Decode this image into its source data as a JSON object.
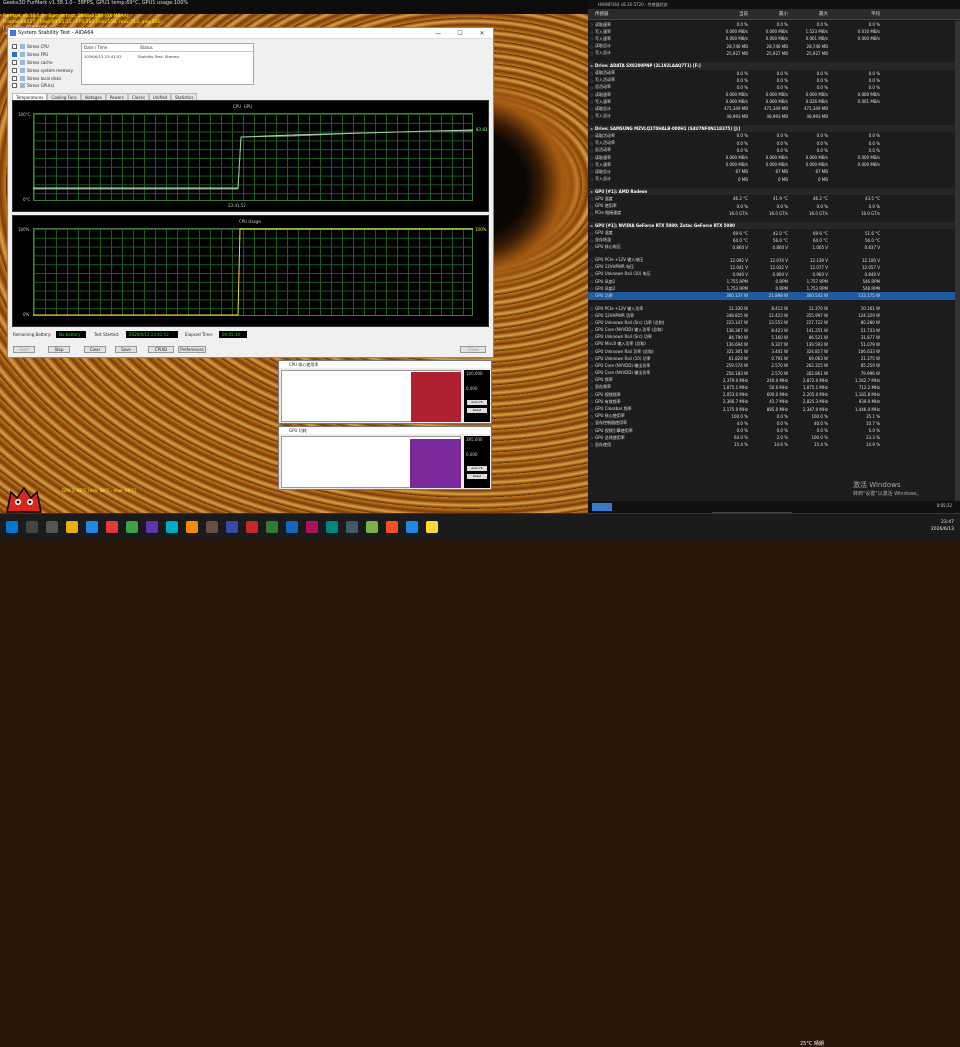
{
  "furmark": {
    "title_line": "Geeks3D FurMark v1.38.1.0 - 38FPS, GPU1 temp:69°C, GPU1 usage:100%",
    "info1": "FurMark v1.38.1.0 - Burn-in test, 2048x1152 (0X MSAA)",
    "info2": "Frames:88517 - time:00:05:15 - FPS:281 (min:159, max:213, avg:306)",
    "info3": "[ GeForce RTX 5080 ]",
    "info4": "- GPU 1 (NVIDIA GeForce RTX 5080) - core: 2887MHz, mem: 15000MHz, GPU load: 100%, mem load: 18%, fan: 31%",
    "bottom": "GPU 1: 68°C (min: 68°C - max: 69°C)"
  },
  "stability": {
    "title": "System Stability Test - AIDA64",
    "checks": [
      {
        "label": "Stress CPU",
        "on": false
      },
      {
        "label": "Stress FPU",
        "on": true
      },
      {
        "label": "Stress cache",
        "on": false
      },
      {
        "label": "Stress system memory",
        "on": false
      },
      {
        "label": "Stress local disks",
        "on": false
      },
      {
        "label": "Stress GPU(s)",
        "on": false
      }
    ],
    "log_headers": [
      "Date / Time",
      "Status"
    ],
    "log_row": {
      "date": "2026/6/13 23:41:52",
      "status": "Stability Test: Started"
    },
    "tabs": [
      "Temperatures",
      "Cooling Fans",
      "Voltages",
      "Powers",
      "Clocks",
      "Unified",
      "Statistics"
    ],
    "graph1": {
      "legend_cpu": "CPU",
      "legend_gpu": "GPU",
      "top": "100°C",
      "bottom": "0°C",
      "time": "23:41:52",
      "value": "83 83"
    },
    "graph2": {
      "title": "CPU Usage",
      "top": "100%",
      "bottom": "0%",
      "value": "100%"
    },
    "remaining_battery_label": "Remaining Battery:",
    "remaining_battery": "No battery",
    "test_started_label": "Test Started:",
    "test_started": "2026/6/13 23:41:52",
    "elapsed_label": "Elapsed Time:",
    "elapsed": "00:05:14",
    "buttons": [
      "Start",
      "Stop",
      "Clear",
      "Save",
      "CPUID",
      "Preferences"
    ],
    "close": "Close",
    "titlebar_controls": [
      "—",
      "☐",
      "✕"
    ]
  },
  "mini1": {
    "title": "CPU 核心使用率",
    "top": "100.000",
    "bottom": "0.000",
    "btn1": "Auto Fit",
    "btn2": "Reset"
  },
  "mini2": {
    "title": "GPU 功耗",
    "top": "395.000",
    "bottom": "0.000",
    "btn1": "Auto Fit",
    "btn2": "Reset"
  },
  "hwinfo": {
    "title": "HWiNFO64 v8.26-5720 - 传感器状态",
    "headers": [
      "传感器",
      "当前",
      "最小",
      "最大",
      "平均"
    ],
    "rows": [
      {
        "t": "",
        "n": "读取速率",
        "c": "0.0 %",
        "mi": "0.0 %",
        "ma": "0.0 %",
        "av": "0.0 %"
      },
      {
        "t": "",
        "n": "写入速率",
        "c": "0.000 MB/s",
        "mi": "0.000 MB/s",
        "ma": "1.523 MB/s",
        "av": "0.010 MB/s"
      },
      {
        "t": "",
        "n": "写入速率",
        "c": "0.000 MB/s",
        "mi": "0.000 MB/s",
        "ma": "0.061 MB/s",
        "av": "0.000 MB/s"
      },
      {
        "t": "",
        "n": "读取总计",
        "c": "28,746 MB",
        "mi": "28,746 MB",
        "ma": "28,746 MB",
        "av": ""
      },
      {
        "t": "",
        "n": "写入总计",
        "c": "25,927 MB",
        "mi": "25,927 MB",
        "ma": "25,927 MB",
        "av": ""
      },
      {
        "t": "sep"
      },
      {
        "t": "grp",
        "n": "Drive: ADATA SX8200PNP (2L192LAAQ7T1) [F:]"
      },
      {
        "t": "",
        "n": "读取活动率",
        "c": "0.0 %",
        "mi": "0.0 %",
        "ma": "0.0 %",
        "av": "0.0 %"
      },
      {
        "t": "",
        "n": "写入活动率",
        "c": "0.0 %",
        "mi": "0.0 %",
        "ma": "0.0 %",
        "av": "0.0 %"
      },
      {
        "t": "",
        "n": "总活动率",
        "c": "0.0 %",
        "mi": "0.0 %",
        "ma": "0.0 %",
        "av": "0.0 %"
      },
      {
        "t": "",
        "n": "读取速率",
        "c": "0.000 MB/s",
        "mi": "0.000 MB/s",
        "ma": "0.000 MB/s",
        "av": "0.000 MB/s"
      },
      {
        "t": "",
        "n": "写入速率",
        "c": "0.000 MB/s",
        "mi": "0.000 MB/s",
        "ma": "0.026 MB/s",
        "av": "0.001 MB/s"
      },
      {
        "t": "",
        "n": "读取总计",
        "c": "471,349 MB",
        "mi": "471,349 MB",
        "ma": "471,349 MB",
        "av": ""
      },
      {
        "t": "",
        "n": "写入总计",
        "c": "48,993 MB",
        "mi": "48,993 MB",
        "ma": "48,993 MB",
        "av": ""
      },
      {
        "t": "sep"
      },
      {
        "t": "grp",
        "n": "Drive: SAMSUNG MZVLQ1T0HALB-000H1 (S4U7NF0N118375) [J:]"
      },
      {
        "t": "",
        "n": "读取活动率",
        "c": "0.0 %",
        "mi": "0.0 %",
        "ma": "0.0 %",
        "av": "0.0 %"
      },
      {
        "t": "",
        "n": "写入活动率",
        "c": "0.0 %",
        "mi": "0.0 %",
        "ma": "0.0 %",
        "av": "0.0 %"
      },
      {
        "t": "",
        "n": "总活动率",
        "c": "0.0 %",
        "mi": "0.0 %",
        "ma": "0.0 %",
        "av": "0.0 %"
      },
      {
        "t": "",
        "n": "读取速率",
        "c": "0.000 MB/s",
        "mi": "0.000 MB/s",
        "ma": "0.000 MB/s",
        "av": "0.000 MB/s"
      },
      {
        "t": "",
        "n": "写入速率",
        "c": "0.000 MB/s",
        "mi": "0.000 MB/s",
        "ma": "0.000 MB/s",
        "av": "0.000 MB/s"
      },
      {
        "t": "",
        "n": "读取总计",
        "c": "67 MB",
        "mi": "67 MB",
        "ma": "67 MB",
        "av": ""
      },
      {
        "t": "",
        "n": "写入总计",
        "c": "0 MB",
        "mi": "0 MB",
        "ma": "0 MB",
        "av": ""
      },
      {
        "t": "sep"
      },
      {
        "t": "grp",
        "n": "GPU [#1]: AMD Radeon"
      },
      {
        "t": "",
        "n": "GPU 温度",
        "c": "46.2 °C",
        "mi": "41.9 °C",
        "ma": "46.2 °C",
        "av": "43.5 °C"
      },
      {
        "t": "",
        "n": "GPU 使用率",
        "c": "0.0 %",
        "mi": "0.0 %",
        "ma": "0.0 %",
        "av": "0.0 %"
      },
      {
        "t": "",
        "n": "PCIe 链接速度",
        "c": "16.0 GT/s",
        "mi": "16.0 GT/s",
        "ma": "16.0 GT/s",
        "av": "16.0 GT/s"
      },
      {
        "t": "sep"
      },
      {
        "t": "grp",
        "n": "GPU [#1]: NVIDIA GeForce RTX 5080: Zotac GeForce RTX 5080"
      },
      {
        "t": "",
        "n": "GPU 温度",
        "c": "69.6 °C",
        "mi": "42.0 °C",
        "ma": "69.6 °C",
        "av": "51.6 °C"
      },
      {
        "t": "",
        "n": "显存结温",
        "c": "64.0 °C",
        "mi": "56.0 °C",
        "ma": "64.0 °C",
        "av": "56.0 °C"
      },
      {
        "t": "",
        "n": "GPU 核心电压",
        "c": "0.860 V",
        "mi": "0.800 V",
        "ma": "1.005 V",
        "av": "0.837 V"
      },
      {
        "t": "sep"
      },
      {
        "t": "",
        "n": "GPU PCIe +12V 输入电压",
        "c": "12.092 V",
        "mi": "12.074 V",
        "ma": "12.139 V",
        "av": "12.100 V"
      },
      {
        "t": "",
        "n": "GPU 12VHPWR 电压",
        "c": "12.041 V",
        "mi": "12.032 V",
        "ma": "12.077 V",
        "av": "12.057 V"
      },
      {
        "t": "",
        "n": "GPU Unknown Rail (10) 电压",
        "c": "0.940 V",
        "mi": "0.800 V",
        "ma": "0.960 V",
        "av": "0.840 V"
      },
      {
        "t": "",
        "n": "GPU 风扇1",
        "c": "1,755 RPM",
        "mi": "0 RPM",
        "ma": "1,757 RPM",
        "av": "546 RPM"
      },
      {
        "t": "",
        "n": "GPU 风扇2",
        "c": "1,753 RPM",
        "mi": "0 RPM",
        "ma": "1,753 RPM",
        "av": "548 RPM"
      },
      {
        "t": "hi",
        "n": "GPU 功率",
        "c": "360.137 W",
        "mi": "21.898 W",
        "ma": "360.542 W",
        "av": "133.175 W"
      },
      {
        "t": "sep"
      },
      {
        "t": "",
        "n": "GPU PCIe +12V 输入功率",
        "c": "11.330 W",
        "mi": "8.412 W",
        "ma": "11.370 W",
        "av": "10.161 W"
      },
      {
        "t": "",
        "n": "GPU 12VHPWR 功率",
        "c": "348.825 W",
        "mi": "12.423 W",
        "ma": "355.997 W",
        "av": "124.329 W"
      },
      {
        "t": "",
        "n": "GPU Unknown Rail (Src) 功率 (总和)",
        "c": "223.147 W",
        "mi": "13.553 W",
        "ma": "227.722 W",
        "av": "80.280 W"
      },
      {
        "t": "",
        "n": "GPU Core (NVVDD) 输入功率 (总和)",
        "c": "138.367 W",
        "mi": "8.423 W",
        "ma": "141.251 W",
        "av": "51.733 W"
      },
      {
        "t": "",
        "n": "GPU Unknown Rail (Src) 功率",
        "c": "84.790 W",
        "mi": "5.160 W",
        "ma": "86.521 W",
        "av": "31.877 W"
      },
      {
        "t": "",
        "n": "GPU Misc0 输入功率 (总和)",
        "c": "136.694 W",
        "mi": "6.327 W",
        "ma": "139.593 W",
        "av": "51.079 W"
      },
      {
        "t": "",
        "n": "GPU Unknown Rail 功率 (总和)",
        "c": "321.301 W",
        "mi": "3.441 W",
        "ma": "324.817 W",
        "av": "106.633 W"
      },
      {
        "t": "",
        "n": "GPU Unknown Rail (10) 功率",
        "c": "61.828 W",
        "mi": "0.791 W",
        "ma": "69.063 W",
        "av": "21.375 W"
      },
      {
        "t": "",
        "n": "GPU Core (NVVDD) 输出功率",
        "c": "259.574 W",
        "mi": "2.570 W",
        "ma": "262.315 W",
        "av": "85.259 W"
      },
      {
        "t": "",
        "n": "GPU Core (NVVDD) 输出功率",
        "c": "256.183 W",
        "mi": "2.570 W",
        "ma": "302.861 W",
        "av": "79.996 W"
      },
      {
        "t": "",
        "n": "GPU 频率",
        "c": "2,379.0 MHz",
        "mi": "240.0 MHz",
        "ma": "2,872.0 MHz",
        "av": "1,162.7 MHz"
      },
      {
        "t": "",
        "n": "显存频率",
        "c": "1,875.1 MHz",
        "mi": "50.6 MHz",
        "ma": "1,875.1 MHz",
        "av": "713.2 MHz"
      },
      {
        "t": "",
        "n": "GPU 视频频率",
        "c": "2,053.0 MHz",
        "mi": "600.0 MHz",
        "ma": "2,205.0 MHz",
        "av": "1,181.8 MHz"
      },
      {
        "t": "",
        "n": "GPU 有效频率",
        "c": "2,366.7 MHz",
        "mi": "41.7 MHz",
        "ma": "2,825.3 MHz",
        "av": "939.0 MHz"
      },
      {
        "t": "",
        "n": "GPU Crossbar 频率",
        "c": "2,175.0 MHz",
        "mi": "885.0 MHz",
        "ma": "2,347.0 MHz",
        "av": "1,446.0 MHz"
      },
      {
        "t": "",
        "n": "GPU 核心使用率",
        "c": "100.0 %",
        "mi": "0.0 %",
        "ma": "100.0 %",
        "av": "35.1 %"
      },
      {
        "t": "",
        "n": "显存控制器使用率",
        "c": "4.0 %",
        "mi": "0.0 %",
        "ma": "40.0 %",
        "av": "10.7 %"
      },
      {
        "t": "",
        "n": "GPU 视频引擎使用率",
        "c": "0.0 %",
        "mi": "0.0 %",
        "ma": "0.0 %",
        "av": "0.0 %"
      },
      {
        "t": "",
        "n": "GPU 总线使用率",
        "c": "64.0 %",
        "mi": "2.0 %",
        "ma": "100.0 %",
        "av": "23.3 %"
      },
      {
        "t": "",
        "n": "显存使用",
        "c": "15.4 %",
        "mi": "14.6 %",
        "ma": "15.4 %",
        "av": "14.9 %"
      }
    ],
    "foot_time": "0:05:32"
  },
  "watermark": {
    "l1": "激活 Windows",
    "l2": "转到\"设置\"以激活 Windows。"
  },
  "ime": [
    "中",
    "⁾",
    "♪",
    "☺",
    "⚙",
    "☺"
  ],
  "taskbar": {
    "weather": "25°C 晴朗",
    "time": "23:47",
    "date": "2026/6/13",
    "lang": "中"
  }
}
